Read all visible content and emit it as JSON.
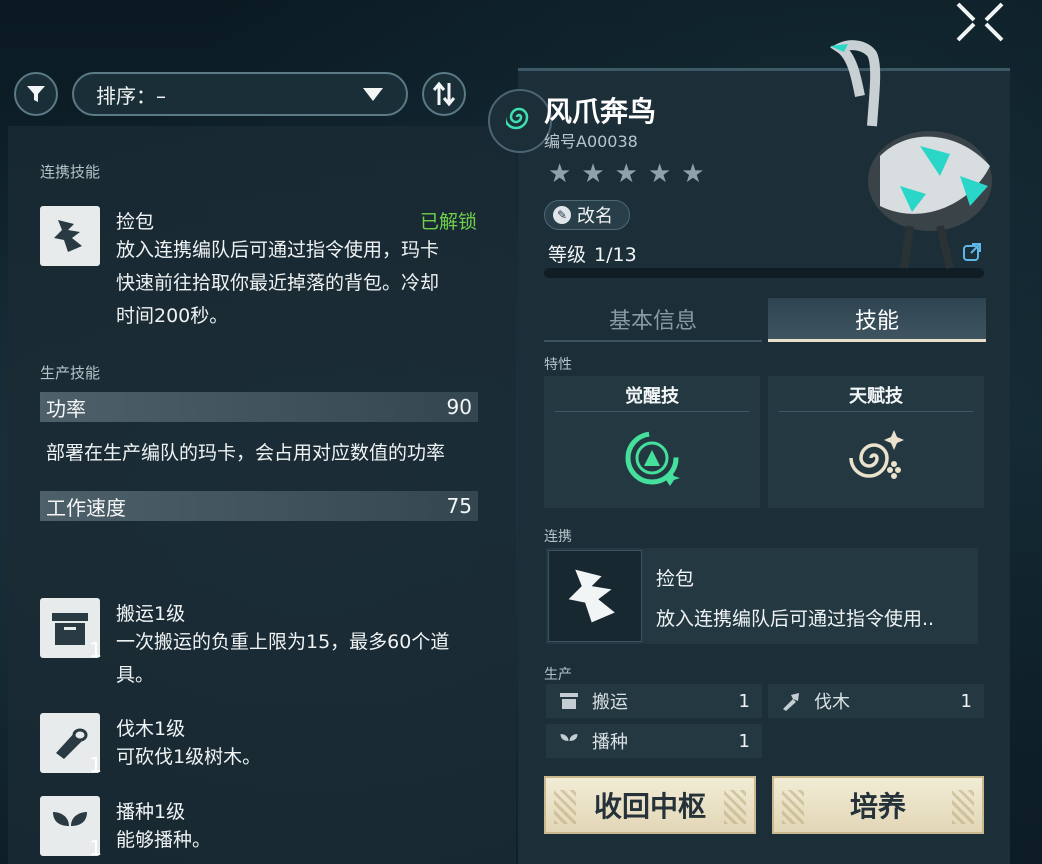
{
  "toolbar": {
    "sort_label": "排序：–"
  },
  "left": {
    "link_section": "连携技能",
    "link_skill": {
      "title": "捡包",
      "status": "已解锁",
      "desc_lines": [
        "放入连携编队后可通过指令使用，玛卡",
        "快速前往拾取你最近掉落的背包。冷却",
        "时间200秒。"
      ]
    },
    "prod_section": "生产技能",
    "power_label": "功率",
    "power_value": "90",
    "power_desc": "部署在生产编队的玛卡，会占用对应数值的功率",
    "speed_label": "工作速度",
    "speed_value": "75",
    "skills": [
      {
        "title": "搬运1级",
        "level": "1",
        "desc_lines": [
          "一次搬运的负重上限为15，最多60个道",
          "具。"
        ],
        "icon": "box-icon"
      },
      {
        "title": "伐木1级",
        "level": "1",
        "desc_lines": [
          "可砍伐1级树木。"
        ],
        "icon": "log-icon"
      },
      {
        "title": "播种1级",
        "level": "1",
        "desc_lines": [
          "能够播种。"
        ],
        "icon": "sprout-icon"
      }
    ]
  },
  "right": {
    "name": "风爪奔鸟",
    "code": "编号A00038",
    "stars": [
      "★",
      "★",
      "★",
      "★",
      "★"
    ],
    "rename": "改名",
    "level_label": "等级",
    "level_value": "1/13",
    "tabs": [
      "基本信息",
      "技能"
    ],
    "trait_section": "特性",
    "trait_cards": [
      "觉醒技",
      "天赋技"
    ],
    "link_section": "连携",
    "link_title": "捡包",
    "link_desc": "放入连携编队后可通过指令使用..",
    "prod_section": "生产",
    "prod": [
      {
        "label": "搬运",
        "count": "1",
        "icon": "box-icon"
      },
      {
        "label": "伐木",
        "count": "1",
        "icon": "axe-icon"
      },
      {
        "label": "播种",
        "count": "1",
        "icon": "sprout-icon"
      }
    ],
    "buttons": [
      "收回中枢",
      "培养"
    ]
  }
}
